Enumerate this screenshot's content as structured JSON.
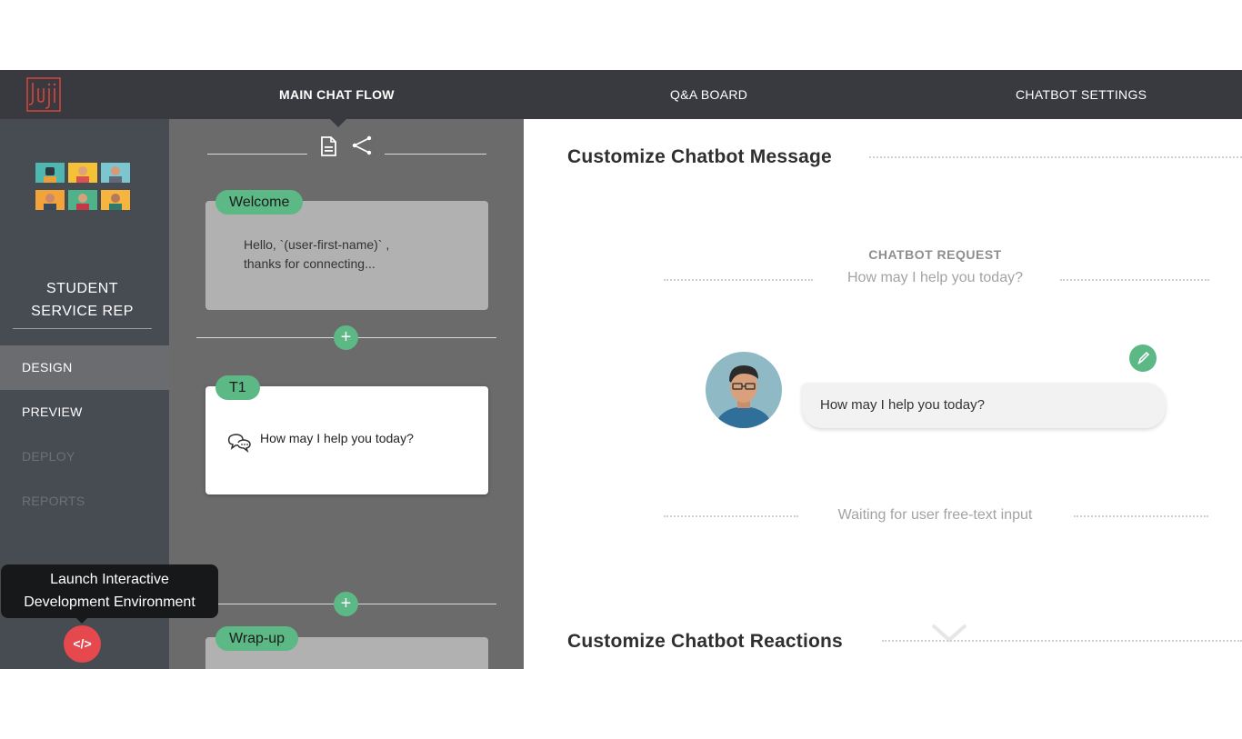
{
  "nav": {
    "logo_text": "Juji",
    "tabs": [
      {
        "label": "MAIN CHAT FLOW",
        "active": true
      },
      {
        "label": "Q&A BOARD",
        "active": false
      },
      {
        "label": "CHATBOT SETTINGS",
        "active": false
      }
    ]
  },
  "sidebar": {
    "bot_name_line1": "STUDENT",
    "bot_name_line2": "SERVICE REP",
    "menu": [
      {
        "label": "DESIGN",
        "state": "active"
      },
      {
        "label": "PREVIEW",
        "state": "enabled"
      },
      {
        "label": "DEPLOY",
        "state": "disabled"
      },
      {
        "label": "REPORTS",
        "state": "disabled"
      }
    ],
    "tooltip_line1": "Launch Interactive",
    "tooltip_line2": "Development Environment",
    "code_button_label": "</>"
  },
  "flow": {
    "toolbar_icons": [
      "document-icon",
      "share-icon"
    ],
    "cards": [
      {
        "tag": "Welcome",
        "text_line1": "Hello, `(user-first-name)` ,",
        "text_line2": "thanks for connecting..."
      },
      {
        "tag": "T1",
        "text": "How may I help you today?"
      },
      {
        "tag": "Wrap-up"
      }
    ],
    "add_icon": "+"
  },
  "main": {
    "message_title": "Customize Chatbot Message",
    "request_label": "CHATBOT REQUEST",
    "request_text": "How may I help you today?",
    "bubble_text": "How may I help you today?",
    "waiting_text": "Waiting for user free-text input",
    "reactions_title": "Customize Chatbot Reactions"
  },
  "colors": {
    "accent_green": "#5cb884",
    "nav_bg": "#383a40",
    "sidebar_bg": "#474b52",
    "flow_bg": "#6b6b6b",
    "launch_red": "#e5484d"
  }
}
